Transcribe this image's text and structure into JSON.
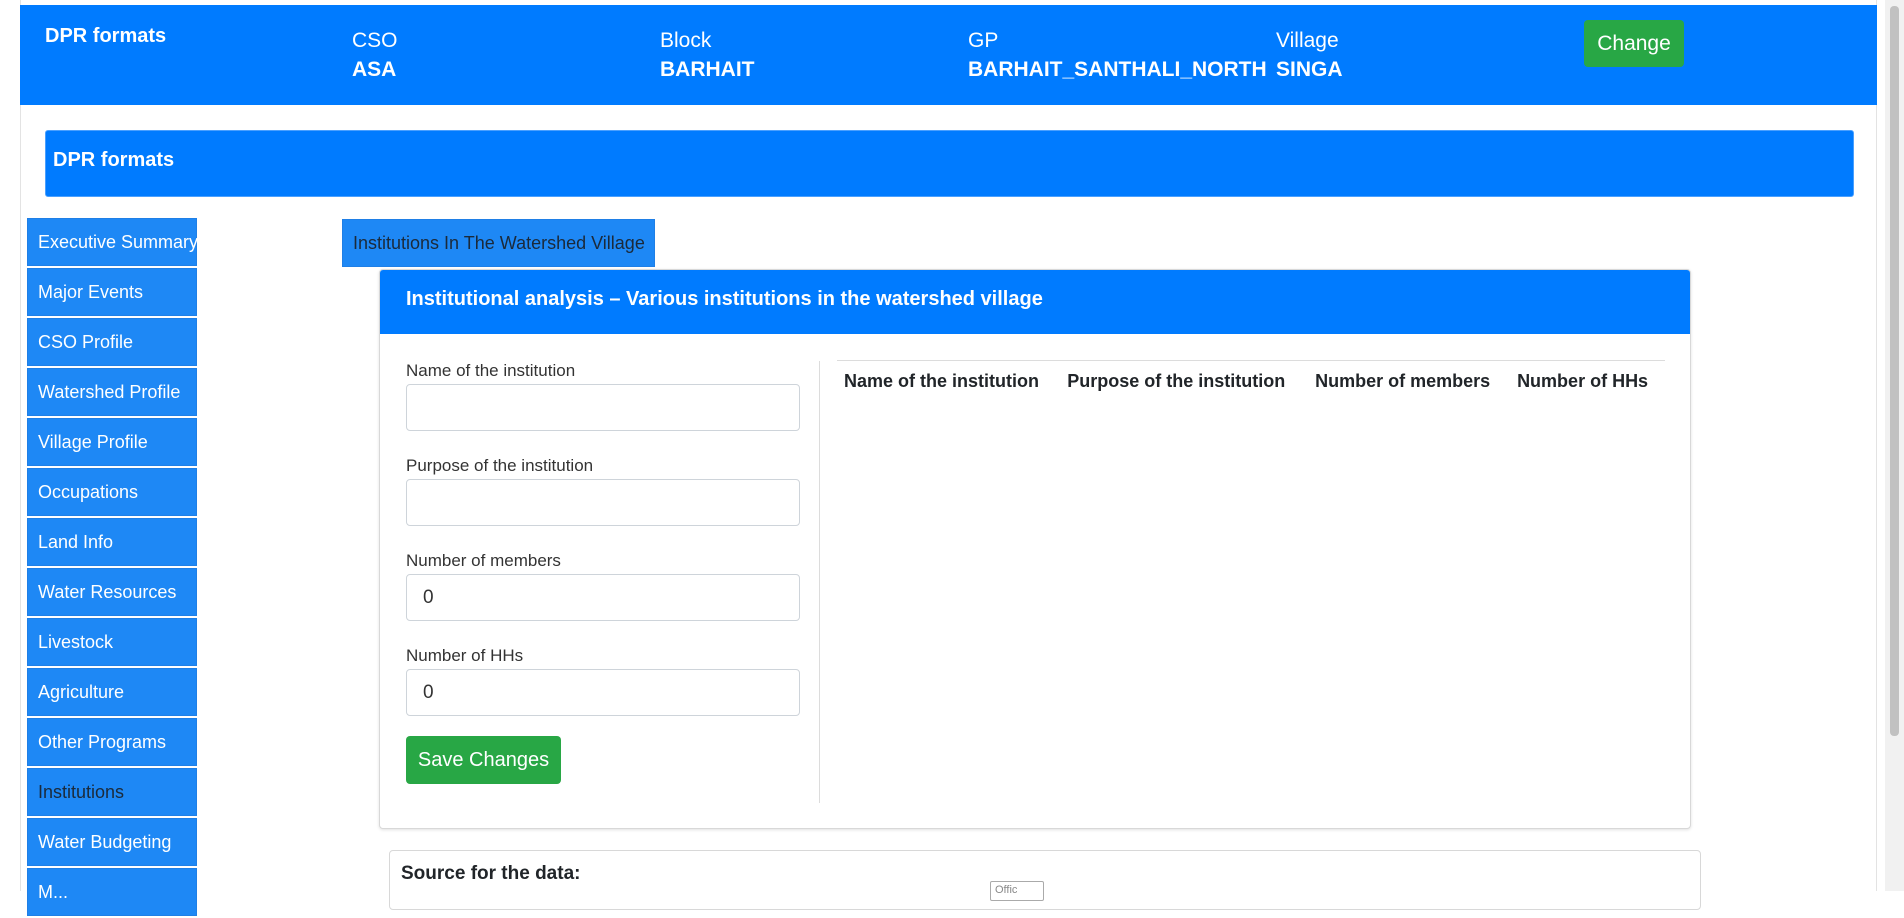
{
  "header": {
    "brand": "DPR formats",
    "fields": [
      {
        "label": "CSO",
        "value": "ASA"
      },
      {
        "label": "Block",
        "value": "BARHAIT"
      },
      {
        "label": "GP",
        "value": "BARHAIT_SANTHALI_NORTH"
      },
      {
        "label": "Village",
        "value": "SINGA"
      }
    ],
    "change_label": "Change"
  },
  "section": {
    "title": "DPR formats"
  },
  "sidebar": {
    "items": [
      {
        "label": "Executive Summary"
      },
      {
        "label": "Major Events"
      },
      {
        "label": "CSO Profile"
      },
      {
        "label": "Watershed Profile"
      },
      {
        "label": "Village Profile"
      },
      {
        "label": "Occupations"
      },
      {
        "label": "Land Info"
      },
      {
        "label": "Water Resources"
      },
      {
        "label": "Livestock"
      },
      {
        "label": "Agriculture"
      },
      {
        "label": "Other Programs"
      },
      {
        "label": "Institutions",
        "active": true
      },
      {
        "label": "Water Budgeting"
      },
      {
        "label": "M..."
      }
    ]
  },
  "tab": {
    "label": "Institutions In The Watershed Village"
  },
  "card": {
    "title": "Institutional analysis – Various institutions in the watershed village",
    "form": {
      "name_label": "Name of the institution",
      "name_value": "",
      "purpose_label": "Purpose of the institution",
      "purpose_value": "",
      "members_label": "Number of members",
      "members_value": "0",
      "hhs_label": "Number of HHs",
      "hhs_value": "0",
      "save_label": "Save Changes"
    },
    "table": {
      "headers": [
        "Name of the institution",
        "Purpose of the institution",
        "Number of members",
        "Number of HHs"
      ]
    }
  },
  "source": {
    "title": "Source for the data:",
    "mini_label": "Offic"
  },
  "colors": {
    "primary": "#007bff",
    "success": "#28a745"
  }
}
